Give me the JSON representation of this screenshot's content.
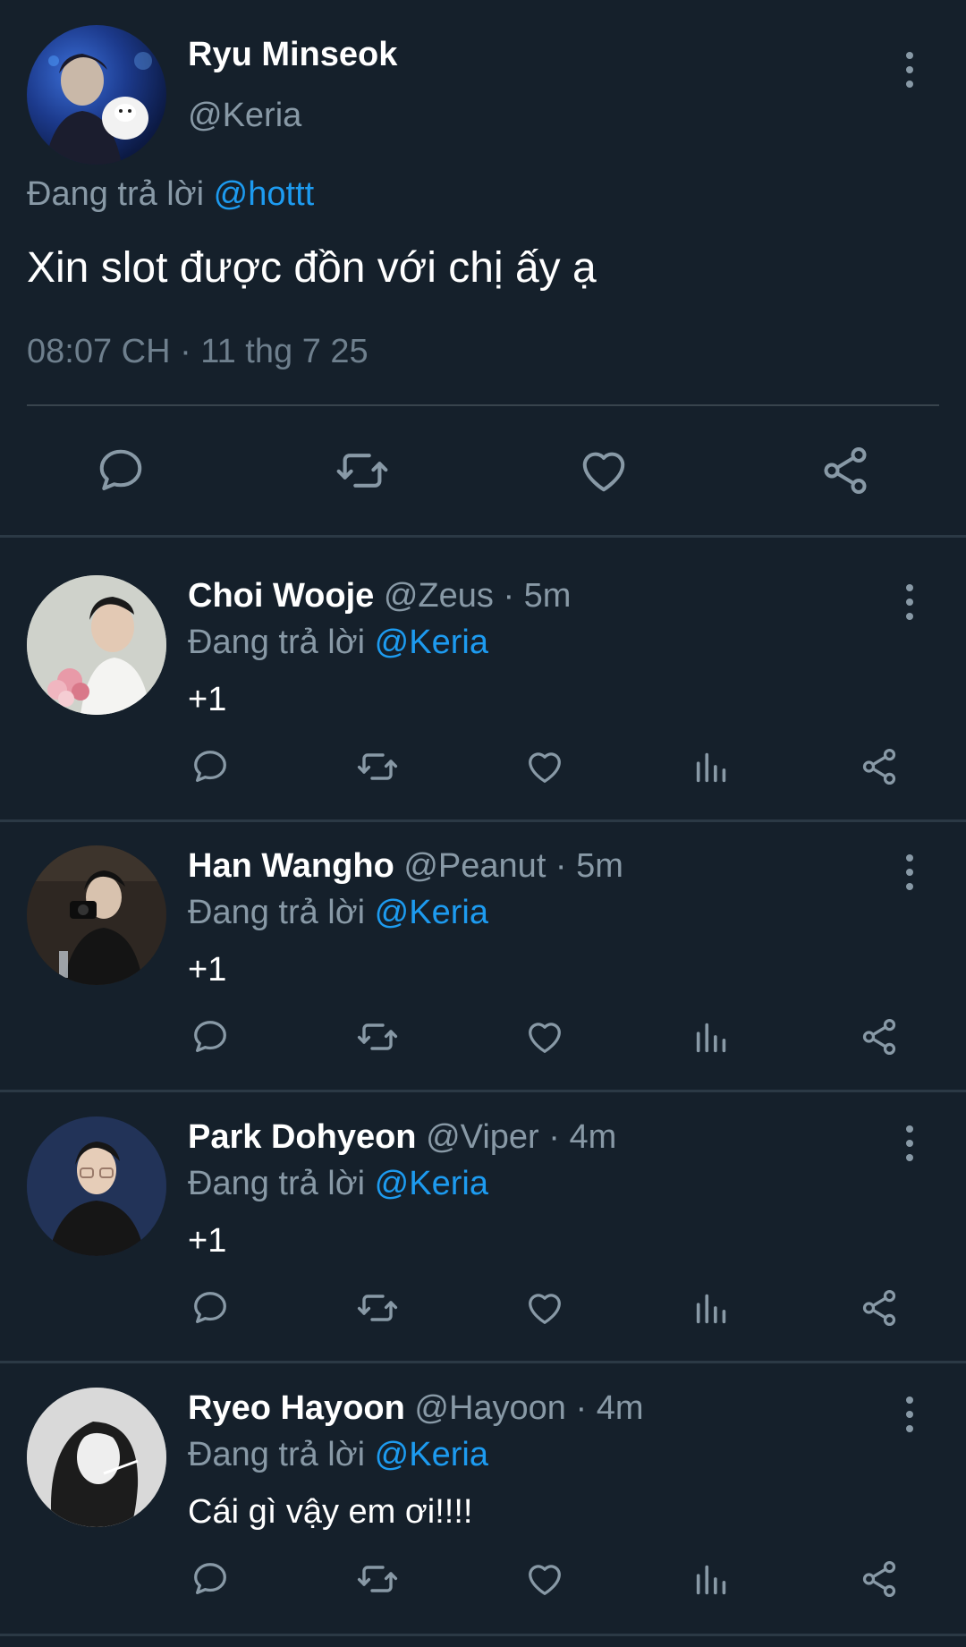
{
  "main_tweet": {
    "name": "Ryu Minseok",
    "handle": "@Keria",
    "replying_prefix": "Đang trả lời",
    "replying_to": "@hottt",
    "text": "Xin slot được đồn với chị ấy ạ",
    "timestamp": "08:07 CH · 11 thg 7 25",
    "actions": [
      "reply-icon",
      "retweet-icon",
      "like-icon",
      "share-icon"
    ]
  },
  "replies": [
    {
      "name": "Choi Wooje",
      "meta": "@Zeus · 5m",
      "replying_prefix": "Đang trả lời",
      "replying_to": "@Keria",
      "text": "+1"
    },
    {
      "name": "Han Wangho",
      "meta": "@Peanut · 5m",
      "replying_prefix": "Đang trả lời",
      "replying_to": "@Keria",
      "text": "+1"
    },
    {
      "name": "Park Dohyeon",
      "meta": "@Viper · 4m",
      "replying_prefix": "Đang trả lời",
      "replying_to": "@Keria",
      "text": "+1"
    },
    {
      "name": "Ryeo Hayoon",
      "meta": "@Hayoon · 4m",
      "replying_prefix": "Đang trả lời",
      "replying_to": "@Keria",
      "text": "Cái gì vậy em ơi!!!!"
    }
  ],
  "reply_actions": [
    "reply-icon",
    "retweet-icon",
    "like-icon",
    "views-icon",
    "share-icon"
  ],
  "colors": {
    "background": "#15202b",
    "divider": "#38444d",
    "secondary_text": "#8899a6",
    "mention": "#1d9bf0",
    "icon": "#8899a6"
  }
}
